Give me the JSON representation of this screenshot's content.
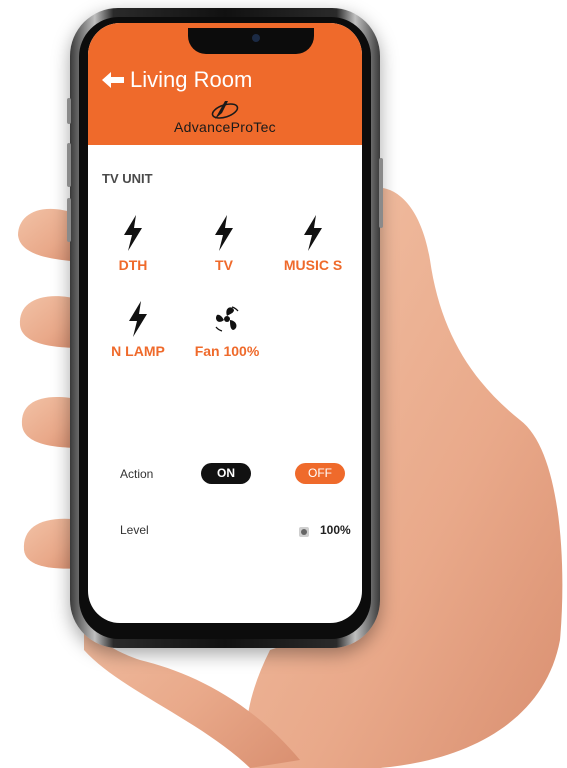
{
  "header": {
    "title": "Living Room",
    "brand": "AdvanceProTec",
    "color": "#ef6a2b"
  },
  "unit": {
    "title": "TV UNIT",
    "devices": [
      {
        "label": "DTH",
        "icon": "bolt-icon"
      },
      {
        "label": "TV",
        "icon": "bolt-icon"
      },
      {
        "label": "MUSIC S",
        "icon": "bolt-icon"
      },
      {
        "label": "N LAMP",
        "icon": "bolt-icon"
      },
      {
        "label": "Fan 100%",
        "icon": "fan-icon"
      }
    ]
  },
  "action": {
    "label": "Action",
    "on": "ON",
    "off": "OFF"
  },
  "level": {
    "label": "Level",
    "value": "100%"
  }
}
